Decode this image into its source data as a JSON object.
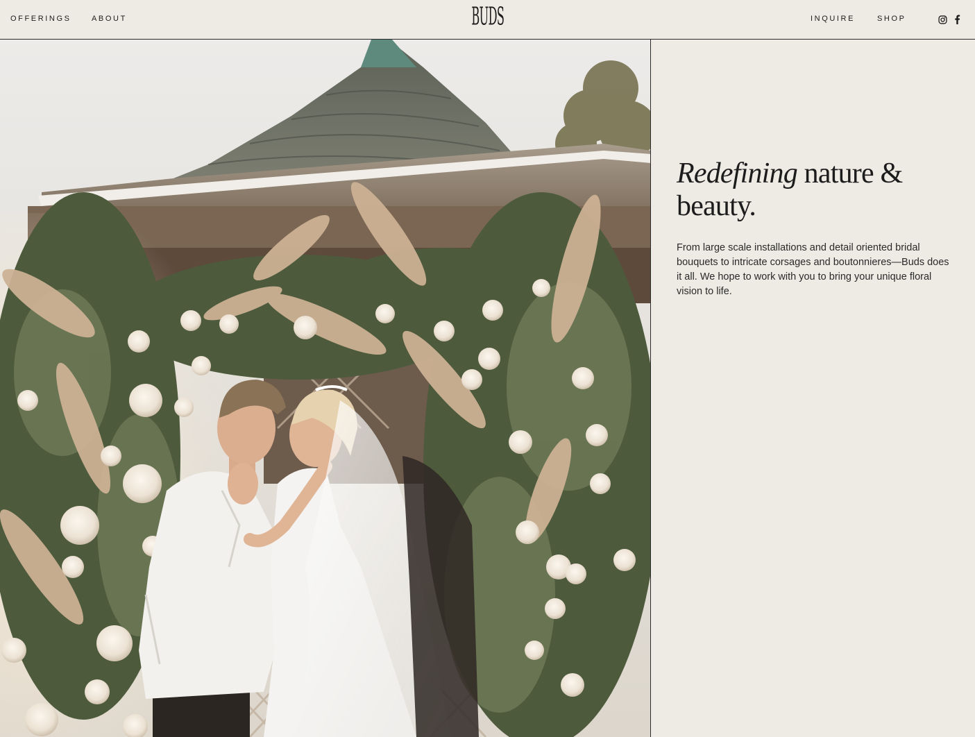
{
  "header": {
    "nav_left": [
      "OFFERINGS",
      "ABOUT"
    ],
    "logo_text": "BUDS",
    "nav_right": [
      "INQUIRE",
      "SHOP"
    ],
    "social_icons": [
      "instagram-icon",
      "facebook-icon"
    ]
  },
  "hero": {
    "image_subject": "wedding-ceremony-floral-arch-photo"
  },
  "content": {
    "headline_italic": "Redefining",
    "headline_rest": " nature & beauty.",
    "body": "From large scale installations and detail oriented bridal bouquets to intricate corsages and boutonnieres—Buds does it all. We hope to work with you to bring your unique floral vision to life."
  },
  "colors": {
    "background": "#eeeae4",
    "text": "#1c1c1c",
    "rule": "#2a2a2a"
  }
}
